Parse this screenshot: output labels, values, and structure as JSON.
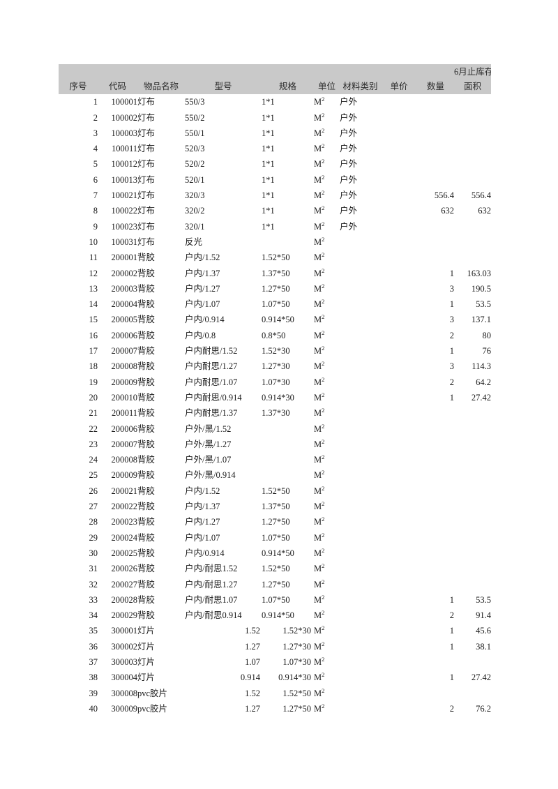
{
  "sheet": {
    "header": {
      "columns": [
        {
          "key": "seq",
          "label": "序号"
        },
        {
          "key": "code",
          "label": "代码"
        },
        {
          "key": "name",
          "label": "物品名称"
        },
        {
          "key": "model",
          "label": "型号"
        },
        {
          "key": "spec",
          "label": "规格"
        },
        {
          "key": "unit",
          "label": "单位"
        },
        {
          "key": "mat",
          "label": "材料类别"
        },
        {
          "key": "price",
          "label": "单价"
        },
        {
          "key": "qty",
          "label": "数量"
        },
        {
          "key": "area",
          "label": "面积"
        }
      ],
      "group_label": "6月止库存",
      "group_sub_labels": [
        "数量",
        "面积"
      ],
      "background_color": "#c9c9c9",
      "divider_color": "#b3b3b3"
    },
    "unit_value": "M",
    "unit_superscript": "2",
    "rows": [
      {
        "seq": "1",
        "code": "100001",
        "name": "灯布",
        "model": "550/3",
        "spec": "1*1",
        "unit": "M",
        "mat": "户外",
        "price": "",
        "qty": "",
        "area": ""
      },
      {
        "seq": "2",
        "code": "100002",
        "name": "灯布",
        "model": "550/2",
        "spec": "1*1",
        "unit": "M",
        "mat": "户外",
        "price": "",
        "qty": "",
        "area": ""
      },
      {
        "seq": "3",
        "code": "100003",
        "name": "灯布",
        "model": "550/1",
        "spec": "1*1",
        "unit": "M",
        "mat": "户外",
        "price": "",
        "qty": "",
        "area": ""
      },
      {
        "seq": "4",
        "code": "100011",
        "name": "灯布",
        "model": "520/3",
        "spec": "1*1",
        "unit": "M",
        "mat": "户外",
        "price": "",
        "qty": "",
        "area": ""
      },
      {
        "seq": "5",
        "code": "100012",
        "name": "灯布",
        "model": "520/2",
        "spec": "1*1",
        "unit": "M",
        "mat": "户外",
        "price": "",
        "qty": "",
        "area": ""
      },
      {
        "seq": "6",
        "code": "100013",
        "name": "灯布",
        "model": "520/1",
        "spec": "1*1",
        "unit": "M",
        "mat": "户外",
        "price": "",
        "qty": "",
        "area": ""
      },
      {
        "seq": "7",
        "code": "100021",
        "name": "灯布",
        "model": "320/3",
        "spec": "1*1",
        "unit": "M",
        "mat": "户外",
        "price": "",
        "qty": "556.4",
        "area": "556.4"
      },
      {
        "seq": "8",
        "code": "100022",
        "name": "灯布",
        "model": "320/2",
        "spec": "1*1",
        "unit": "M",
        "mat": "户外",
        "price": "",
        "qty": "632",
        "area": "632"
      },
      {
        "seq": "9",
        "code": "100023",
        "name": "灯布",
        "model": "320/1",
        "spec": "1*1",
        "unit": "M",
        "mat": "户外",
        "price": "",
        "qty": "",
        "area": ""
      },
      {
        "seq": "10",
        "code": "100031",
        "name": "灯布",
        "model": "反光",
        "spec": "",
        "unit": "M",
        "mat": "",
        "price": "",
        "qty": "",
        "area": ""
      },
      {
        "seq": "11",
        "code": "200001",
        "name": "背胶",
        "model": "户内/1.52",
        "spec": "1.52*50",
        "unit": "M",
        "mat": "",
        "price": "",
        "qty": "",
        "area": ""
      },
      {
        "seq": "12",
        "code": "200002",
        "name": "背胶",
        "model": "户内/1.37",
        "spec": "1.37*50",
        "unit": "M",
        "mat": "",
        "price": "",
        "qty": "1",
        "area": "163.03"
      },
      {
        "seq": "13",
        "code": "200003",
        "name": "背胶",
        "model": "户内/1.27",
        "spec": "1.27*50",
        "unit": "M",
        "mat": "",
        "price": "",
        "qty": "3",
        "area": "190.5"
      },
      {
        "seq": "14",
        "code": "200004",
        "name": "背胶",
        "model": "户内/1.07",
        "spec": "1.07*50",
        "unit": "M",
        "mat": "",
        "price": "",
        "qty": "1",
        "area": "53.5"
      },
      {
        "seq": "15",
        "code": "200005",
        "name": "背胶",
        "model": "户内/0.914",
        "spec": "0.914*50",
        "unit": "M",
        "mat": "",
        "price": "",
        "qty": "3",
        "area": "137.1"
      },
      {
        "seq": "16",
        "code": "200006",
        "name": "背胶",
        "model": "户内/0.8",
        "spec": "0.8*50",
        "unit": "M",
        "mat": "",
        "price": "",
        "qty": "2",
        "area": "80"
      },
      {
        "seq": "17",
        "code": "200007",
        "name": "背胶",
        "model": "户内耐思/1.52",
        "spec": "1.52*30",
        "unit": "M",
        "mat": "",
        "price": "",
        "qty": "1",
        "area": "76"
      },
      {
        "seq": "18",
        "code": "200008",
        "name": "背胶",
        "model": "户内耐思/1.27",
        "spec": "1.27*30",
        "unit": "M",
        "mat": "",
        "price": "",
        "qty": "3",
        "area": "114.3"
      },
      {
        "seq": "19",
        "code": "200009",
        "name": "背胶",
        "model": "户内耐思/1.07",
        "spec": "1.07*30",
        "unit": "M",
        "mat": "",
        "price": "",
        "qty": "2",
        "area": "64.2"
      },
      {
        "seq": "20",
        "code": "200010",
        "name": "背胶",
        "model": "户内耐思/0.914",
        "spec": "0.914*30",
        "unit": "M",
        "mat": "",
        "price": "",
        "qty": "1",
        "area": "27.42"
      },
      {
        "seq": "21",
        "code": "200011",
        "name": "背胶",
        "model": "户内耐思/1.37",
        "spec": "1.37*30",
        "unit": "M",
        "mat": "",
        "price": "",
        "qty": "",
        "area": ""
      },
      {
        "seq": "22",
        "code": "200006",
        "name": "背胶",
        "model": "户外/黑/1.52",
        "spec": "",
        "unit": "M",
        "mat": "",
        "price": "",
        "qty": "",
        "area": ""
      },
      {
        "seq": "23",
        "code": "200007",
        "name": "背胶",
        "model": "户外/黑/1.27",
        "spec": "",
        "unit": "M",
        "mat": "",
        "price": "",
        "qty": "",
        "area": ""
      },
      {
        "seq": "24",
        "code": "200008",
        "name": "背胶",
        "model": "户外/黑/1.07",
        "spec": "",
        "unit": "M",
        "mat": "",
        "price": "",
        "qty": "",
        "area": ""
      },
      {
        "seq": "25",
        "code": "200009",
        "name": "背胶",
        "model": "户外/黑/0.914",
        "spec": "",
        "unit": "M",
        "mat": "",
        "price": "",
        "qty": "",
        "area": ""
      },
      {
        "seq": "26",
        "code": "200021",
        "name": "背胶",
        "model": "户内/1.52",
        "spec": "1.52*50",
        "unit": "M",
        "mat": "",
        "price": "",
        "qty": "",
        "area": ""
      },
      {
        "seq": "27",
        "code": "200022",
        "name": "背胶",
        "model": "户内/1.37",
        "spec": "1.37*50",
        "unit": "M",
        "mat": "",
        "price": "",
        "qty": "",
        "area": ""
      },
      {
        "seq": "28",
        "code": "200023",
        "name": "背胶",
        "model": "户内/1.27",
        "spec": "1.27*50",
        "unit": "M",
        "mat": "",
        "price": "",
        "qty": "",
        "area": ""
      },
      {
        "seq": "29",
        "code": "200024",
        "name": "背胶",
        "model": "户内/1.07",
        "spec": "1.07*50",
        "unit": "M",
        "mat": "",
        "price": "",
        "qty": "",
        "area": ""
      },
      {
        "seq": "30",
        "code": "200025",
        "name": "背胶",
        "model": "户内/0.914",
        "spec": "0.914*50",
        "unit": "M",
        "mat": "",
        "price": "",
        "qty": "",
        "area": ""
      },
      {
        "seq": "31",
        "code": "200026",
        "name": "背胶",
        "model": "户内/耐思1.52",
        "spec": "1.52*50",
        "unit": "M",
        "mat": "",
        "price": "",
        "qty": "",
        "area": ""
      },
      {
        "seq": "32",
        "code": "200027",
        "name": "背胶",
        "model": "户内/耐思1.27",
        "spec": "1.27*50",
        "unit": "M",
        "mat": "",
        "price": "",
        "qty": "",
        "area": ""
      },
      {
        "seq": "33",
        "code": "200028",
        "name": "背胶",
        "model": "户内/耐思1.07",
        "spec": "1.07*50",
        "unit": "M",
        "mat": "",
        "price": "",
        "qty": "1",
        "area": "53.5"
      },
      {
        "seq": "34",
        "code": "200029",
        "name": "背胶",
        "model": "户内/耐思0.914",
        "spec": "0.914*50",
        "unit": "M",
        "mat": "",
        "price": "",
        "qty": "2",
        "area": "91.4"
      },
      {
        "seq": "35",
        "code": "300001",
        "name": "灯片",
        "model": "1.52",
        "spec": "1.52*30",
        "unit": "M",
        "mat": "",
        "price": "",
        "qty": "1",
        "area": "45.6",
        "numright": true
      },
      {
        "seq": "36",
        "code": "300002",
        "name": "灯片",
        "model": "1.27",
        "spec": "1.27*30",
        "unit": "M",
        "mat": "",
        "price": "",
        "qty": "1",
        "area": "38.1",
        "numright": true
      },
      {
        "seq": "37",
        "code": "300003",
        "name": "灯片",
        "model": "1.07",
        "spec": "1.07*30",
        "unit": "M",
        "mat": "",
        "price": "",
        "qty": "",
        "area": "",
        "numright": true
      },
      {
        "seq": "38",
        "code": "300004",
        "name": "灯片",
        "model": "0.914",
        "spec": "0.914*30",
        "unit": "M",
        "mat": "",
        "price": "",
        "qty": "1",
        "area": "27.42",
        "numright": true
      },
      {
        "seq": "39",
        "code": "300008",
        "name": "pvc胶片",
        "model": "1.52",
        "spec": "1.52*50",
        "unit": "M",
        "mat": "",
        "price": "",
        "qty": "",
        "area": "",
        "numright": true
      },
      {
        "seq": "40",
        "code": "300009",
        "name": "pvc胶片",
        "model": "1.27",
        "spec": "1.27*50",
        "unit": "M",
        "mat": "",
        "price": "",
        "qty": "2",
        "area": "76.2",
        "numright": true
      }
    ]
  }
}
